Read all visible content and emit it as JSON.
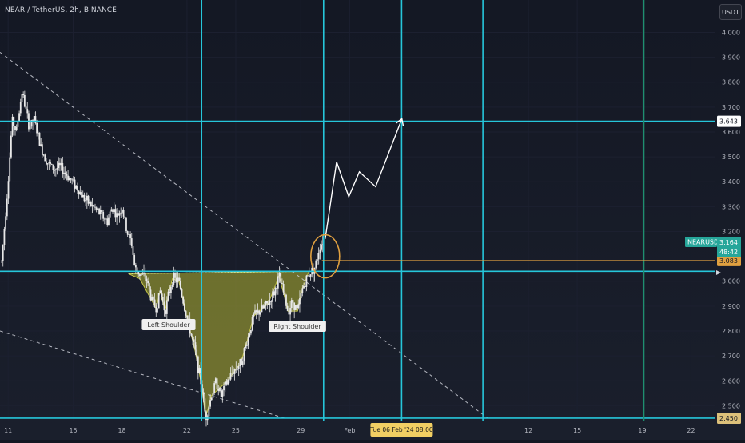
{
  "header": {
    "symbol_title": "NEAR / TetherUS, 2h, BINANCE",
    "currency_button": "USDT"
  },
  "colors": {
    "background": "#131722",
    "grid": "#1c2030",
    "candle": "#e8e8e8",
    "level_line": "#26c6da",
    "pattern_fill": "#b5b533",
    "current_price_line": "#e0a040",
    "ticker_badge": "#26a69a",
    "annotation_label_bg": "#f0f0f0",
    "dotted_trendline": "#d1d4dc"
  },
  "crosshair_label": "Tue 06 Feb '24   08:00",
  "labels": {
    "left_shoulder": "Left Shoulder",
    "right_shoulder": "Right Shoulder"
  },
  "price_badges": {
    "ticker": "NEARUSDT",
    "last_price": "3.164",
    "countdown": "48:42",
    "current_level": "3.083",
    "target_level": "3.643",
    "bottom_level": "2.450"
  },
  "chart_data": {
    "type": "candlestick",
    "symbol": "NEARUSDT",
    "exchange": "BINANCE",
    "interval": "2h",
    "x_ticks": [
      "11",
      "15",
      "18",
      "22",
      "25",
      "29",
      "Feb",
      "12",
      "15",
      "19",
      "22"
    ],
    "x_tick_days": [
      11,
      15,
      18,
      22,
      25,
      29,
      32,
      43,
      46,
      50,
      53
    ],
    "x_range_days": [
      10.5,
      54.5
    ],
    "y_ticks": [
      "4.000",
      "3.900",
      "3.800",
      "3.700",
      "3.600",
      "3.500",
      "3.400",
      "3.300",
      "3.200",
      "3.000",
      "2.900",
      "2.800",
      "2.700",
      "2.600",
      "2.500"
    ],
    "y_range": [
      2.437,
      4.13
    ],
    "price_path": [
      [
        10.6,
        3.08
      ],
      [
        11.0,
        3.4
      ],
      [
        11.25,
        3.65
      ],
      [
        11.5,
        3.6
      ],
      [
        11.85,
        3.76
      ],
      [
        12.05,
        3.7
      ],
      [
        12.3,
        3.62
      ],
      [
        12.6,
        3.65
      ],
      [
        13.0,
        3.54
      ],
      [
        13.4,
        3.48
      ],
      [
        13.8,
        3.45
      ],
      [
        14.2,
        3.46
      ],
      [
        14.7,
        3.42
      ],
      [
        15.2,
        3.38
      ],
      [
        15.7,
        3.33
      ],
      [
        16.2,
        3.3
      ],
      [
        16.7,
        3.27
      ],
      [
        17.1,
        3.24
      ],
      [
        17.4,
        3.3
      ],
      [
        17.7,
        3.26
      ],
      [
        18.0,
        3.3
      ],
      [
        18.3,
        3.2
      ],
      [
        18.6,
        3.15
      ],
      [
        18.8,
        3.05
      ],
      [
        19.1,
        3.03
      ],
      [
        19.5,
        3.01
      ],
      [
        19.8,
        2.93
      ],
      [
        20.1,
        2.89
      ],
      [
        20.35,
        2.96
      ],
      [
        20.65,
        2.88
      ],
      [
        21.1,
        3.01
      ],
      [
        21.5,
        3.0
      ],
      [
        21.9,
        2.88
      ],
      [
        22.5,
        2.72
      ],
      [
        22.9,
        2.58
      ],
      [
        23.15,
        2.45
      ],
      [
        23.5,
        2.54
      ],
      [
        23.8,
        2.6
      ],
      [
        24.1,
        2.54
      ],
      [
        24.5,
        2.6
      ],
      [
        24.85,
        2.64
      ],
      [
        25.3,
        2.67
      ],
      [
        25.7,
        2.76
      ],
      [
        26.1,
        2.86
      ],
      [
        26.5,
        2.88
      ],
      [
        27.0,
        2.91
      ],
      [
        27.4,
        2.96
      ],
      [
        27.65,
        3.02
      ],
      [
        27.95,
        2.95
      ],
      [
        28.2,
        2.88
      ],
      [
        28.5,
        2.92
      ],
      [
        28.8,
        2.88
      ],
      [
        29.1,
        2.97
      ],
      [
        29.5,
        3.03
      ],
      [
        29.9,
        3.06
      ],
      [
        30.15,
        3.14
      ],
      [
        30.35,
        3.16
      ]
    ],
    "projected_path": [
      [
        30.5,
        3.17
      ],
      [
        31.2,
        3.48
      ],
      [
        31.95,
        3.34
      ],
      [
        32.6,
        3.44
      ],
      [
        33.6,
        3.38
      ],
      [
        35.2,
        3.65
      ]
    ],
    "horizontal_levels": [
      {
        "price": 3.643,
        "role": "target"
      },
      {
        "price": 3.04,
        "role": "neckline"
      },
      {
        "price": 2.45,
        "role": "bottom"
      }
    ],
    "current_price_level": 3.083,
    "vertical_lines_days": [
      22.9,
      30.4,
      35.2,
      40.2,
      50.1
    ],
    "vertical_lines_colors": [
      "#26c6da",
      "#26c6da",
      "#26c6da",
      "#26c6da",
      "#1f8f6f"
    ],
    "trendlines": [
      {
        "from": [
          10.5,
          3.92
        ],
        "to": [
          40.5,
          2.45
        ],
        "style": "dashed"
      },
      {
        "from": [
          10.5,
          2.8
        ],
        "to": [
          28.0,
          2.45
        ],
        "style": "dashed"
      }
    ],
    "head_and_shoulders_polygon": [
      [
        18.4,
        3.03
      ],
      [
        19.1,
        3.01
      ],
      [
        20.1,
        2.89
      ],
      [
        20.35,
        2.96
      ],
      [
        20.65,
        2.88
      ],
      [
        21.1,
        3.01
      ],
      [
        21.5,
        3.0
      ],
      [
        21.9,
        2.88
      ],
      [
        22.5,
        2.72
      ],
      [
        22.9,
        2.58
      ],
      [
        23.15,
        2.45
      ],
      [
        23.5,
        2.54
      ],
      [
        24.5,
        2.6
      ],
      [
        25.3,
        2.67
      ],
      [
        25.7,
        2.76
      ],
      [
        26.1,
        2.86
      ],
      [
        27.0,
        2.91
      ],
      [
        27.65,
        3.02
      ],
      [
        27.95,
        2.95
      ],
      [
        28.2,
        2.88
      ],
      [
        28.8,
        2.88
      ],
      [
        29.1,
        2.97
      ],
      [
        29.5,
        3.04
      ]
    ],
    "highlight_ellipse": {
      "center_day": 30.5,
      "center_price": 3.1
    }
  }
}
